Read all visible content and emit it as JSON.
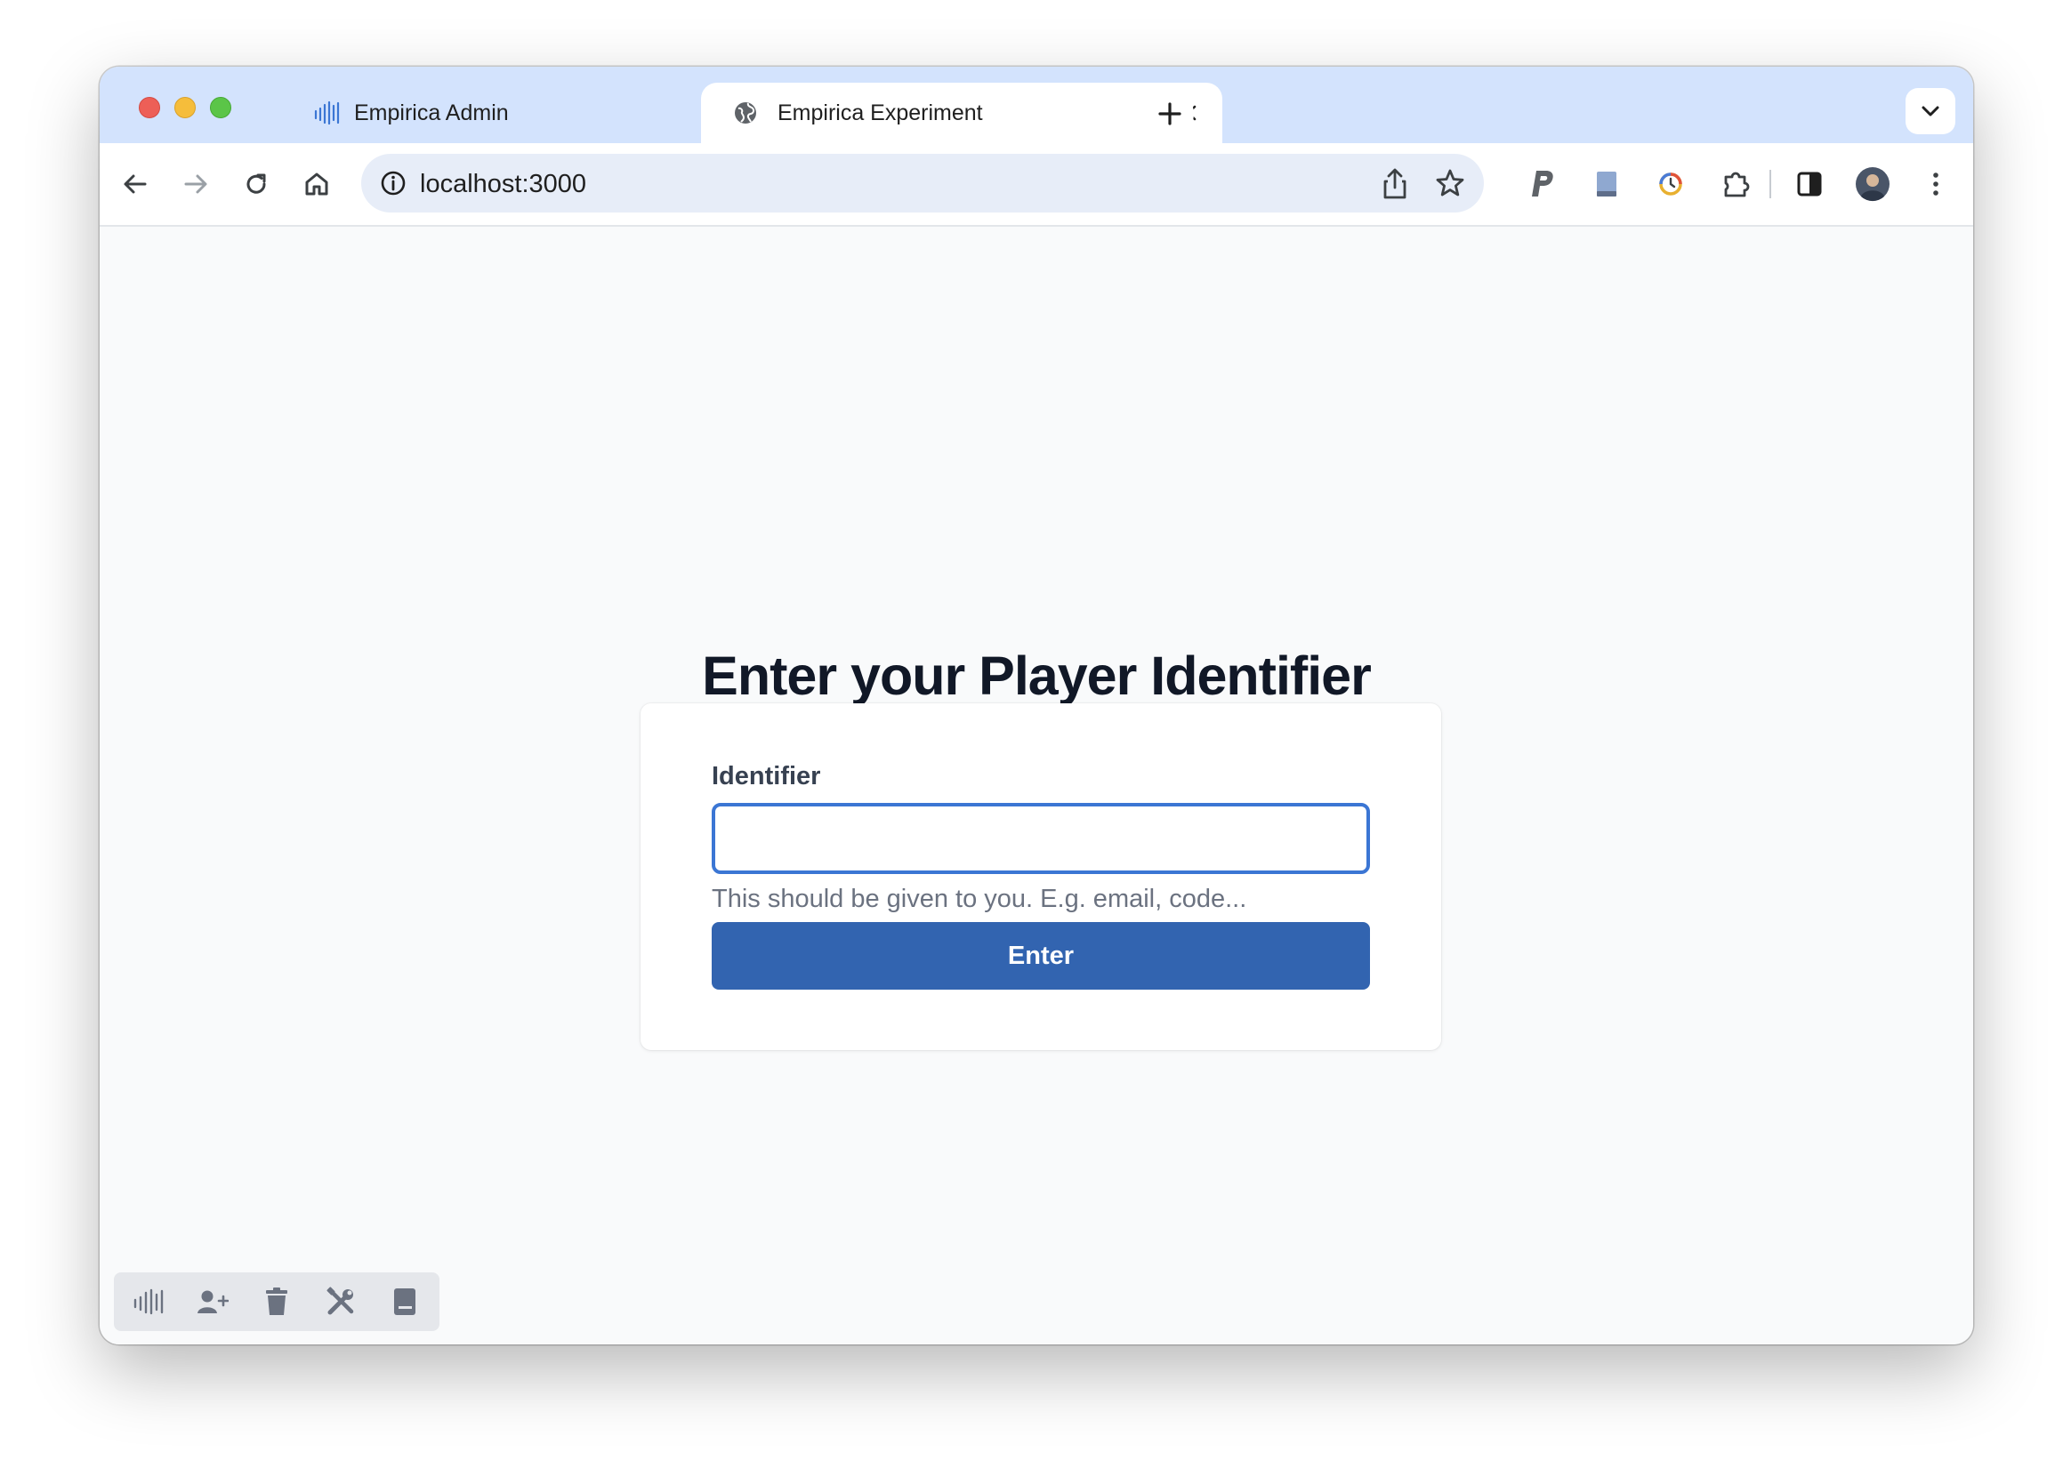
{
  "browser": {
    "tabs": [
      {
        "title": "Empirica Admin",
        "icon": "empirica-logo-icon",
        "active": false
      },
      {
        "title": "Empirica Experiment",
        "icon": "globe-icon",
        "active": true
      }
    ],
    "address_bar": {
      "url": "localhost:3000"
    },
    "toolbar_icons": [
      "back-arrow-icon",
      "forward-arrow-icon",
      "reload-icon",
      "home-icon",
      "share-icon",
      "bookmark-star-icon",
      "paypal-extension-icon",
      "book-extension-icon",
      "clock-extension-icon",
      "extensions-puzzle-icon",
      "side-panel-icon",
      "profile-avatar",
      "more-menu-icon"
    ]
  },
  "page": {
    "title": "Enter your Player Identifier",
    "form": {
      "label": "Identifier",
      "value": "",
      "help_text": "This should be given to you. E.g. email, code...",
      "submit_label": "Enter"
    }
  },
  "dev_toolbar": {
    "icons": [
      "empirica-logo-icon",
      "add-player-icon",
      "trash-icon",
      "tools-icon",
      "book-icon"
    ]
  },
  "colors": {
    "tabstrip": "#d3e3fd",
    "omnibox": "#e7edf8",
    "primary_button": "#3264b0",
    "input_focus_border": "#3b76d4",
    "title_text": "#111827"
  }
}
